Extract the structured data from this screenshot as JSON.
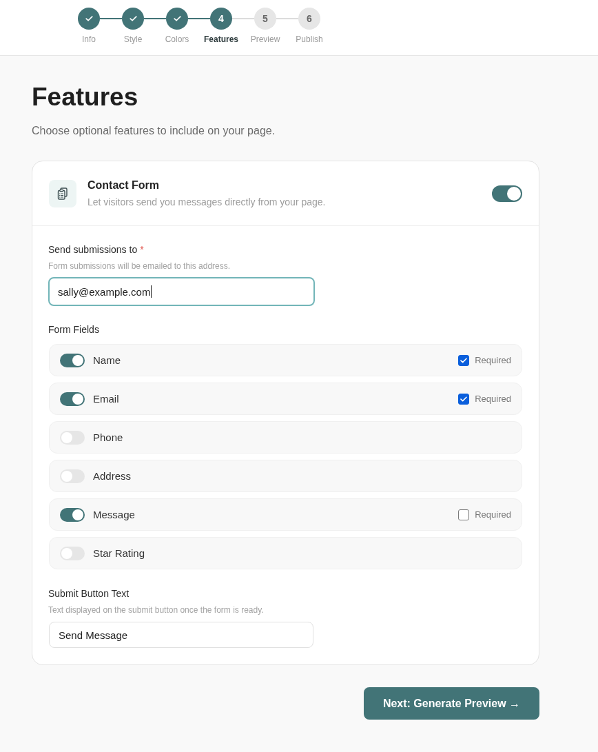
{
  "stepper": {
    "steps": [
      {
        "label": "Info",
        "completed": true,
        "selected": false
      },
      {
        "label": "Style",
        "completed": true,
        "selected": false
      },
      {
        "label": "Colors",
        "completed": true,
        "selected": false
      },
      {
        "label": "Features",
        "number": "4",
        "completed": false,
        "selected": true
      },
      {
        "label": "Preview",
        "number": "5",
        "completed": false,
        "selected": false
      },
      {
        "label": "Publish",
        "number": "6",
        "completed": false,
        "selected": false
      }
    ]
  },
  "page": {
    "title": "Features",
    "subtitle": "Choose optional features to include on your page."
  },
  "feature_card": {
    "title": "Contact Form",
    "description": "Let visitors send you messages directly from your page.",
    "on": true,
    "email_setting": {
      "label": "Send submissions to",
      "required_mark": "*",
      "hint": "Form submissions will be emailed to this address.",
      "value": "sally@example.com",
      "focused": true
    },
    "form_fields": {
      "heading": "Form Fields",
      "items": [
        {
          "label": "Name",
          "on": true,
          "required": true,
          "required_label": "Required"
        },
        {
          "label": "Email",
          "on": true,
          "required": true,
          "required_label": "Required"
        },
        {
          "label": "Phone",
          "on": false
        },
        {
          "label": "Address",
          "on": false
        },
        {
          "label": "Message",
          "on": true,
          "required": false,
          "required_label": "Required"
        },
        {
          "label": "Star Rating",
          "on": false
        }
      ]
    },
    "submit_text_setting": {
      "label": "Submit Button Text",
      "hint": "Text displayed on the submit button once the form is ready.",
      "value": "Send Message",
      "focused": false
    }
  },
  "next_button": {
    "label": "Next: Generate Preview →"
  }
}
